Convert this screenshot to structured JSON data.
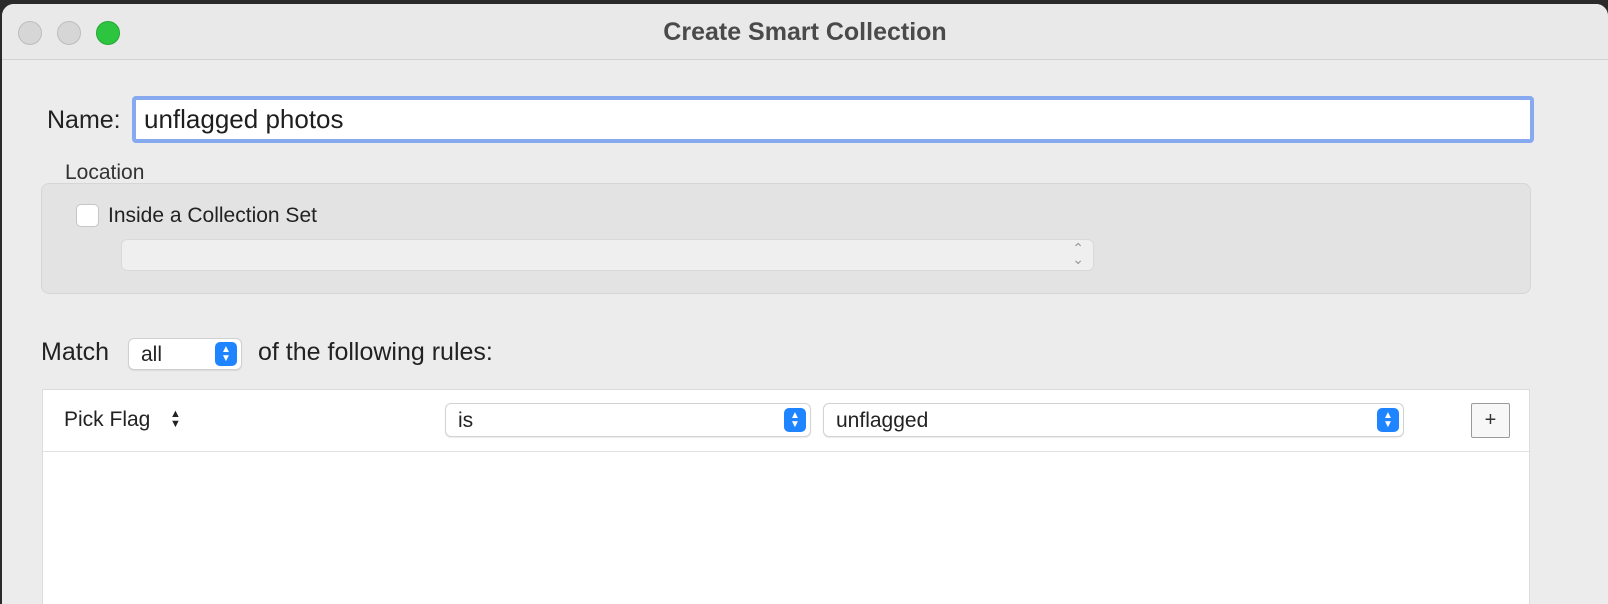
{
  "window": {
    "title": "Create Smart Collection"
  },
  "name": {
    "label": "Name:",
    "value": "unflagged photos"
  },
  "location": {
    "label": "Location",
    "checkbox_label": "Inside a Collection Set",
    "checkbox_checked": false,
    "collection_set_value": ""
  },
  "match": {
    "label": "Match",
    "value": "all",
    "tail": "of the following rules:"
  },
  "rules": [
    {
      "field": "Pick Flag",
      "operator": "is",
      "value": "unflagged",
      "add_label": "+"
    }
  ],
  "colors": {
    "accent": "#1f84ff",
    "focus_ring": "#86a9f0",
    "zoom_button": "#2dc43f"
  }
}
